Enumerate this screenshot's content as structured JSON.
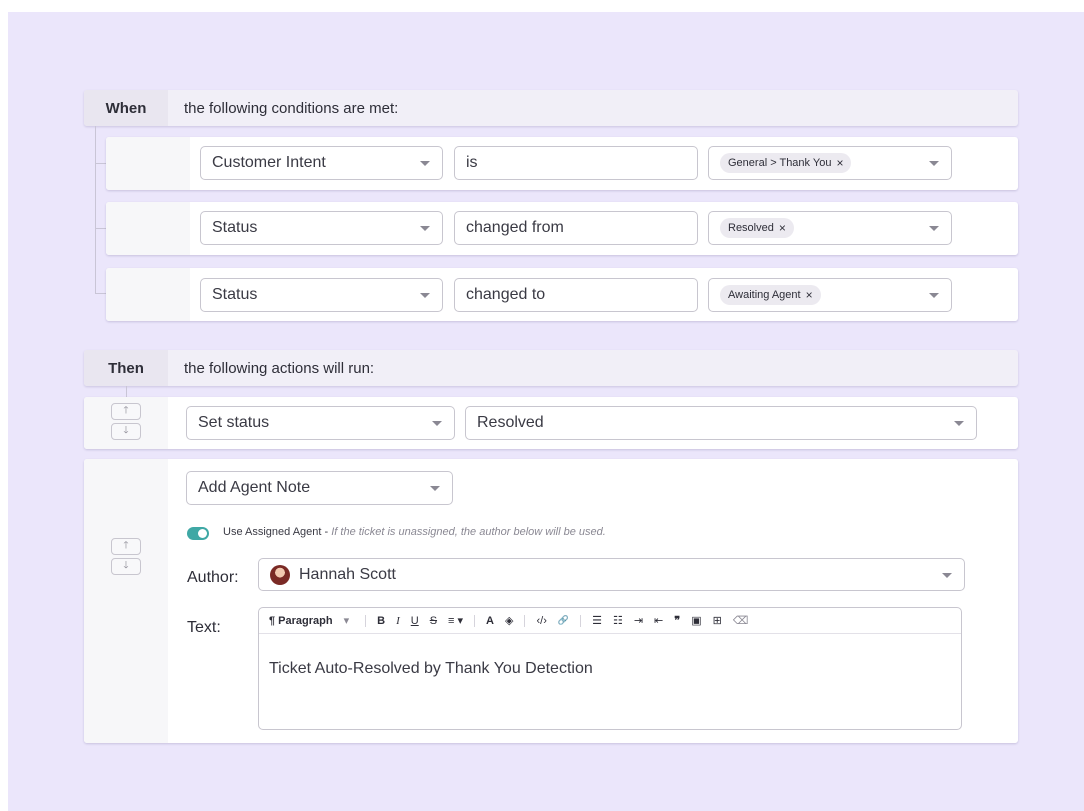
{
  "when": {
    "keyword": "When",
    "description": "the following conditions are met:",
    "conditions": [
      {
        "field": "Customer Intent",
        "operator": "is",
        "value_chip": "General > Thank You"
      },
      {
        "field": "Status",
        "operator": "changed from",
        "value_chip": "Resolved"
      },
      {
        "field": "Status",
        "operator": "changed to",
        "value_chip": "Awaiting Agent"
      }
    ],
    "chip_remove": "×"
  },
  "then": {
    "keyword": "Then",
    "description": "the following actions will run:",
    "actions": [
      {
        "type": "Set status",
        "value": "Resolved"
      },
      {
        "type": "Add Agent Note",
        "toggle_label": "Use Assigned Agent - ",
        "toggle_hint": "If the ticket is unassigned, the author below will be used.",
        "toggle_on": true,
        "author_label": "Author:",
        "author_name": "Hannah Scott",
        "text_label": "Text:",
        "toolbar": {
          "paragraph": "¶ Paragraph",
          "dropdown": "▾",
          "bold": "B",
          "italic": "I",
          "underline": "U",
          "strike": "S",
          "align": "≡ ▾",
          "font_color": "A",
          "fill": "◈",
          "code": "‹/›",
          "link": "🔗",
          "bullet_list": "☰",
          "ordered_list": "☷",
          "indent": "⇥",
          "outdent": "⇤",
          "quote": "❞",
          "image": "▣",
          "table": "⊞",
          "clear": "⌫"
        },
        "text_value": "Ticket Auto-Resolved by Thank You Detection"
      }
    ]
  },
  "arrows": {
    "up": "🡑",
    "down": "🡓"
  },
  "colors": {
    "background": "#ebe6fb",
    "toggle": "#3fa8a5"
  }
}
